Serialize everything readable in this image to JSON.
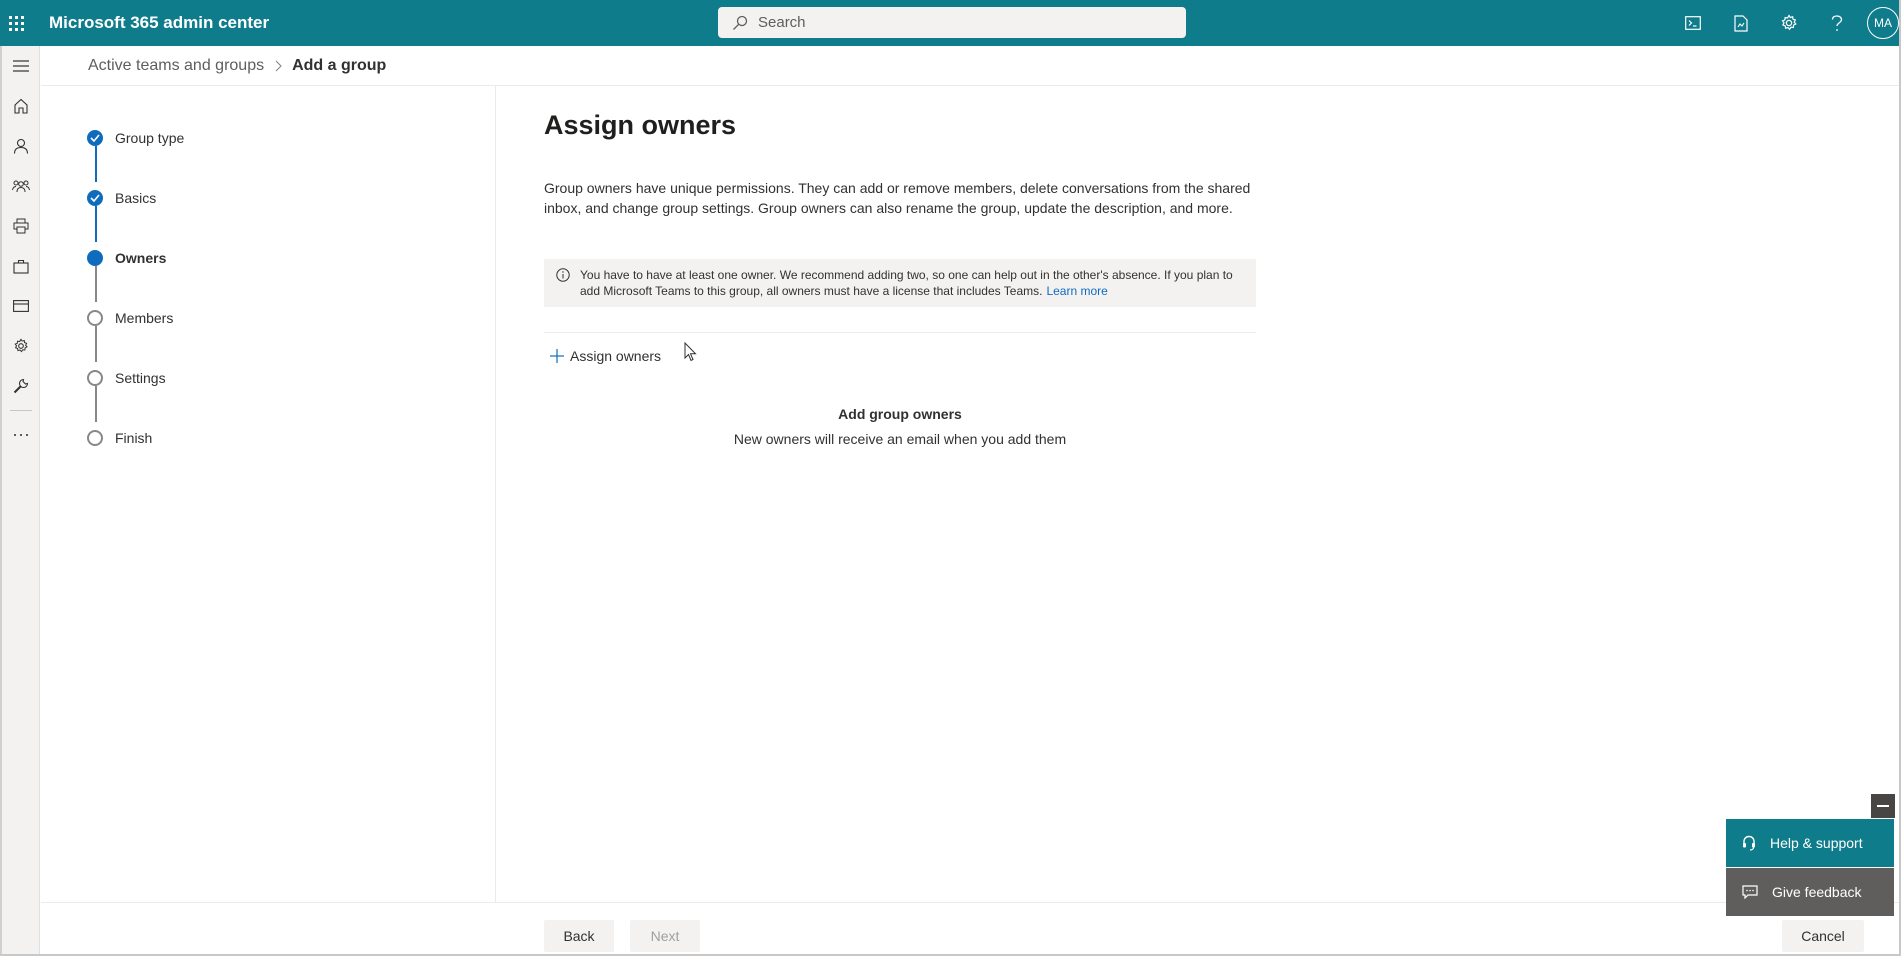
{
  "header": {
    "app_title": "Microsoft 365 admin center",
    "search_placeholder": "Search",
    "avatar_initials": "MA"
  },
  "rail": {
    "items": [
      "menu-icon",
      "home-icon",
      "user-icon",
      "groups-icon",
      "printer-icon",
      "briefcase-icon",
      "billing-icon",
      "settings-icon",
      "wrench-icon",
      "more-icon"
    ]
  },
  "breadcrumb": {
    "parent": "Active teams and groups",
    "current": "Add a group"
  },
  "steps": [
    {
      "label": "Group type",
      "state": "done"
    },
    {
      "label": "Basics",
      "state": "done"
    },
    {
      "label": "Owners",
      "state": "current"
    },
    {
      "label": "Members",
      "state": "pending"
    },
    {
      "label": "Settings",
      "state": "pending"
    },
    {
      "label": "Finish",
      "state": "pending"
    }
  ],
  "main": {
    "title": "Assign owners",
    "description": "Group owners have unique permissions. They can add or remove members, delete conversations from the shared inbox, and change group settings. Group owners can also rename the group, update the description, and more.",
    "notice_text": "You have to have at least one owner. We recommend adding two, so one can help out in the other's absence. If you plan to add Microsoft Teams to this group, all owners must have a license that includes Teams.",
    "notice_link": "Learn more",
    "assign_button": "Assign owners",
    "empty_title": "Add group owners",
    "empty_subtitle": "New owners will receive an email when you add them"
  },
  "footer": {
    "back": "Back",
    "next": "Next",
    "cancel": "Cancel"
  },
  "help": {
    "help_support": "Help & support",
    "give_feedback": "Give feedback"
  },
  "colors": {
    "header": "#0f7c8c",
    "accent": "#0f6cbd"
  }
}
